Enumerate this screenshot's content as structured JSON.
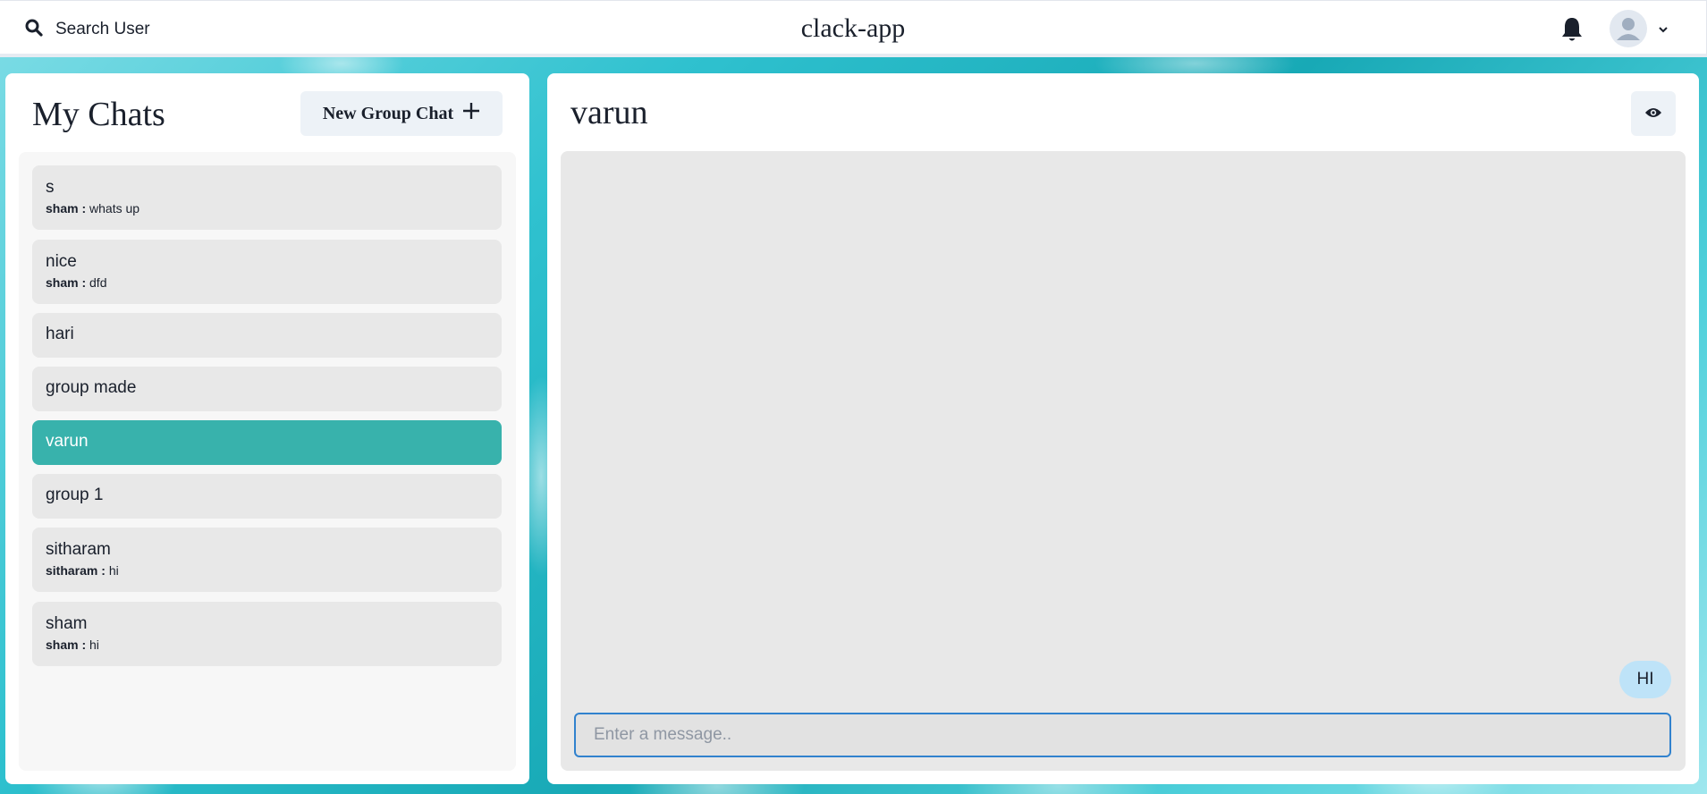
{
  "topbar": {
    "search_label": "Search User",
    "app_title": "clack-app"
  },
  "chats": {
    "title": "My Chats",
    "new_group_label": "New Group Chat",
    "items": [
      {
        "name": "s",
        "sender": "sham :",
        "preview": "whats up"
      },
      {
        "name": "nice",
        "sender": "sham :",
        "preview": "dfd"
      },
      {
        "name": "hari"
      },
      {
        "name": "group made"
      },
      {
        "name": "varun",
        "selected": true
      },
      {
        "name": "group 1"
      },
      {
        "name": "sitharam",
        "sender": "sitharam :",
        "preview": "hi"
      },
      {
        "name": "sham",
        "sender": "sham :",
        "preview": "hi"
      }
    ]
  },
  "conversation": {
    "title": "varun",
    "messages": [
      {
        "text": "HI",
        "from_self": true
      }
    ],
    "input_placeholder": "Enter a message.."
  },
  "colors": {
    "selected_chat": "#38b2ac",
    "bubble": "#bee3f8",
    "input_border": "#3182ce"
  },
  "icons": [
    "search-icon",
    "bell-icon",
    "avatar-icon",
    "chevron-down-icon",
    "plus-icon",
    "eye-icon"
  ]
}
